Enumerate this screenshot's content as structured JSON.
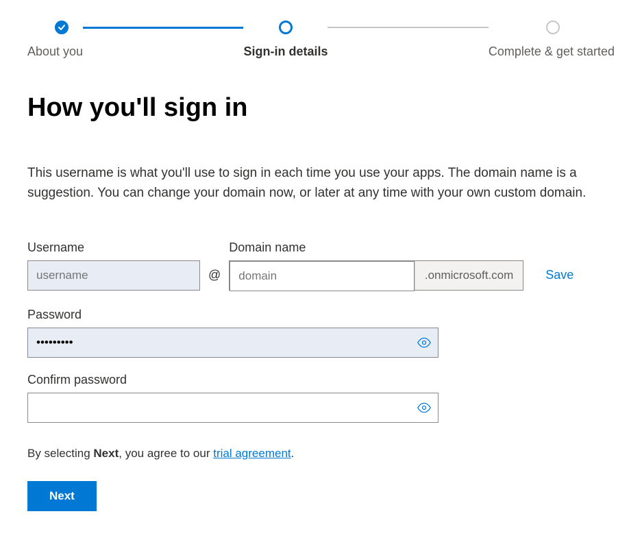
{
  "stepper": {
    "steps": [
      {
        "label": "About you"
      },
      {
        "label": "Sign-in details"
      },
      {
        "label": "Complete & get started"
      }
    ]
  },
  "heading": "How you'll sign in",
  "description": "This username is what you'll use to sign in each time you use your apps. The domain name is a suggestion. You can change your domain now, or later at any time with your own custom domain.",
  "form": {
    "username": {
      "label": "Username",
      "placeholder": "username",
      "value": ""
    },
    "at": "@",
    "domain": {
      "label": "Domain name",
      "placeholder": "domain",
      "value": "",
      "suffix": ".onmicrosoft.com"
    },
    "save": "Save",
    "password": {
      "label": "Password",
      "value": "•••••••••"
    },
    "confirm": {
      "label": "Confirm password",
      "value": ""
    }
  },
  "agreement": {
    "prefix": "By selecting ",
    "bold": "Next",
    "middle": ", you agree to our ",
    "link": "trial agreement",
    "suffix": "."
  },
  "next": "Next"
}
